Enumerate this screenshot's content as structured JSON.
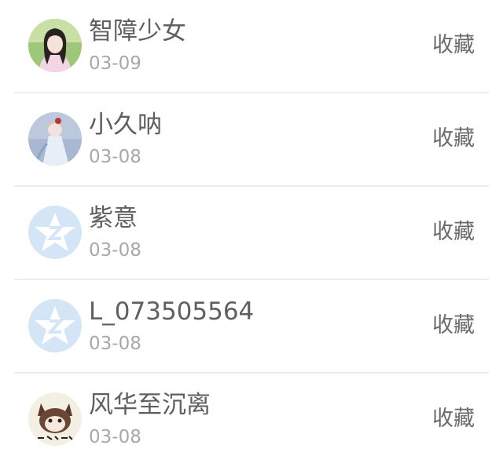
{
  "action_label": "收藏",
  "items": [
    {
      "name": "智障少女",
      "date": "03-09",
      "avatar": "girl-portrait-avatar"
    },
    {
      "name": "小久呐",
      "date": "03-08",
      "avatar": "anime-girl-avatar"
    },
    {
      "name": "紫意",
      "date": "03-08",
      "avatar": "default-qq-avatar"
    },
    {
      "name": "L_073505564",
      "date": "03-08",
      "avatar": "default-qq-avatar"
    },
    {
      "name": "风华至沉离",
      "date": "03-08",
      "avatar": "cartoon-cat-avatar"
    }
  ],
  "colors": {
    "default_avatar_bg": "#d4e6f5",
    "default_avatar_mark": "#ffffff",
    "divider": "#ececec"
  }
}
